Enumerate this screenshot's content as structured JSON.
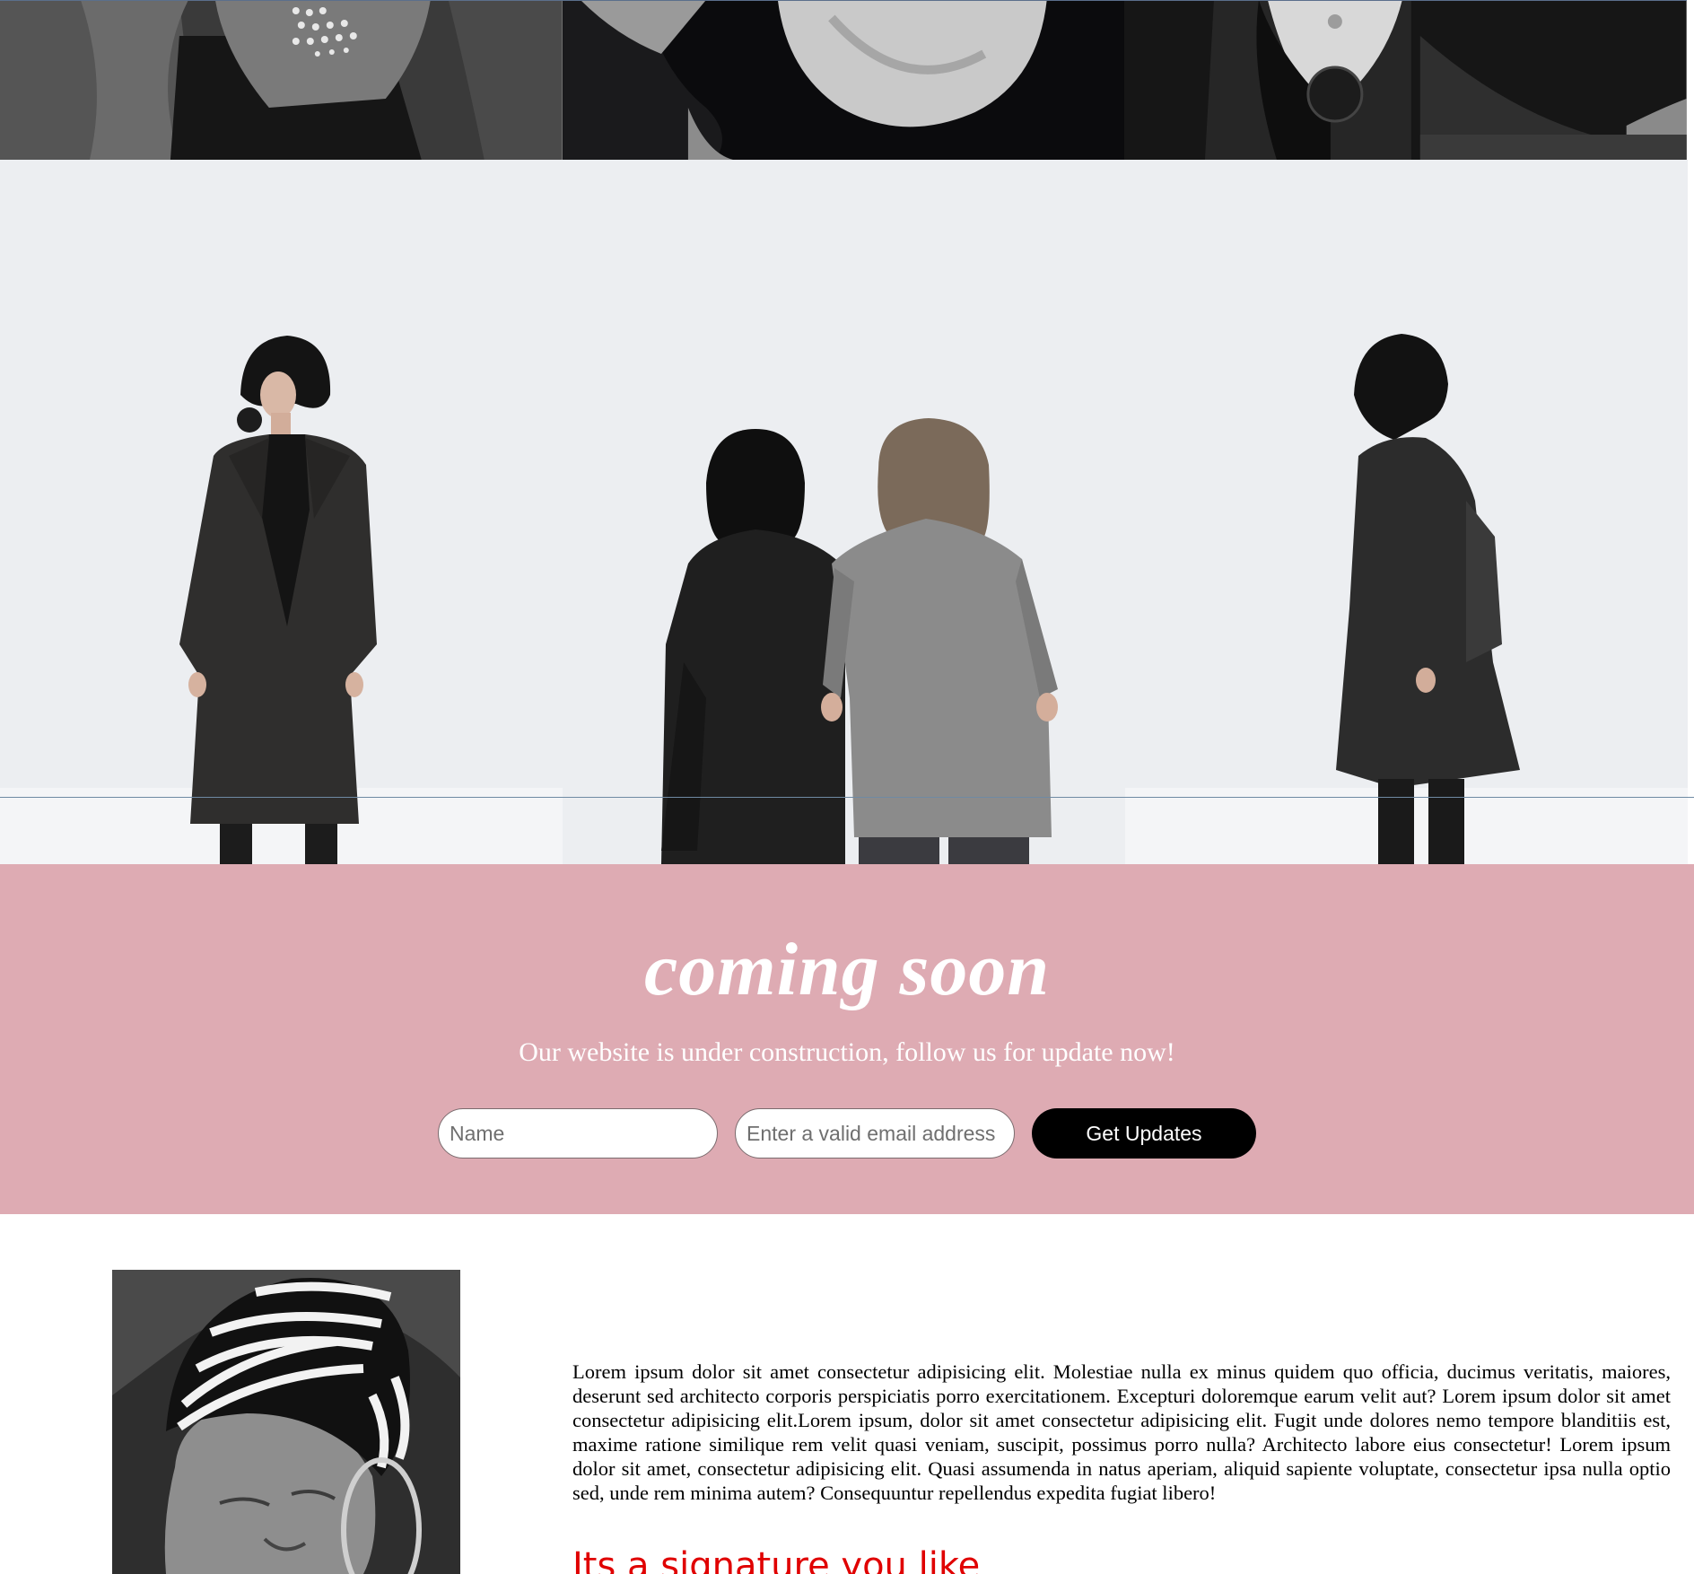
{
  "top_strip": {
    "tiles": [
      {
        "icon": "photo-hands-closeup"
      },
      {
        "icon": "photo-neck-closeup"
      },
      {
        "icon": "photo-embroidered-detail"
      }
    ]
  },
  "gallery": {
    "tiles": [
      {
        "icon": "photo-woman-black-coat-front"
      },
      {
        "icon": "photo-two-women-back"
      },
      {
        "icon": "photo-woman-coat-side"
      }
    ]
  },
  "coming_soon": {
    "title": "coming soon",
    "subtitle": "Our website is under construction, follow us for update now!",
    "name_placeholder": "Name",
    "email_placeholder": "Enter a valid email address",
    "button_label": "Get Updates",
    "background_color": "#deabb3",
    "button_color": "#000000"
  },
  "about": {
    "photo_icon": "photo-woman-striped-headwrap",
    "body": "Lorem ipsum dolor sit amet consectetur adipisicing elit. Molestiae nulla ex minus quidem quo officia, ducimus veritatis, maiores, deserunt sed architecto corporis perspiciatis porro exercitationem. Excepturi doloremque earum velit aut? Lorem ipsum dolor sit amet consectetur adipisicing elit.Lorem ipsum, dolor sit amet consectetur adipisicing elit. Fugit unde dolores nemo tempore blanditiis est, maxime ratione similique rem velit quasi veniam, suscipit, possimus porro nulla? Architecto labore eius consectetur! Lorem ipsum dolor sit amet, consectetur adipisicing elit. Quasi assumenda in natus aperiam, aliquid sapiente voluptate, consectetur ipsa nulla optio sed, unde rem minima autem? Consequuntur repellendus expedita fugiat libero!",
    "signature": "Its a signature you like",
    "signature_color": "#e00000"
  }
}
